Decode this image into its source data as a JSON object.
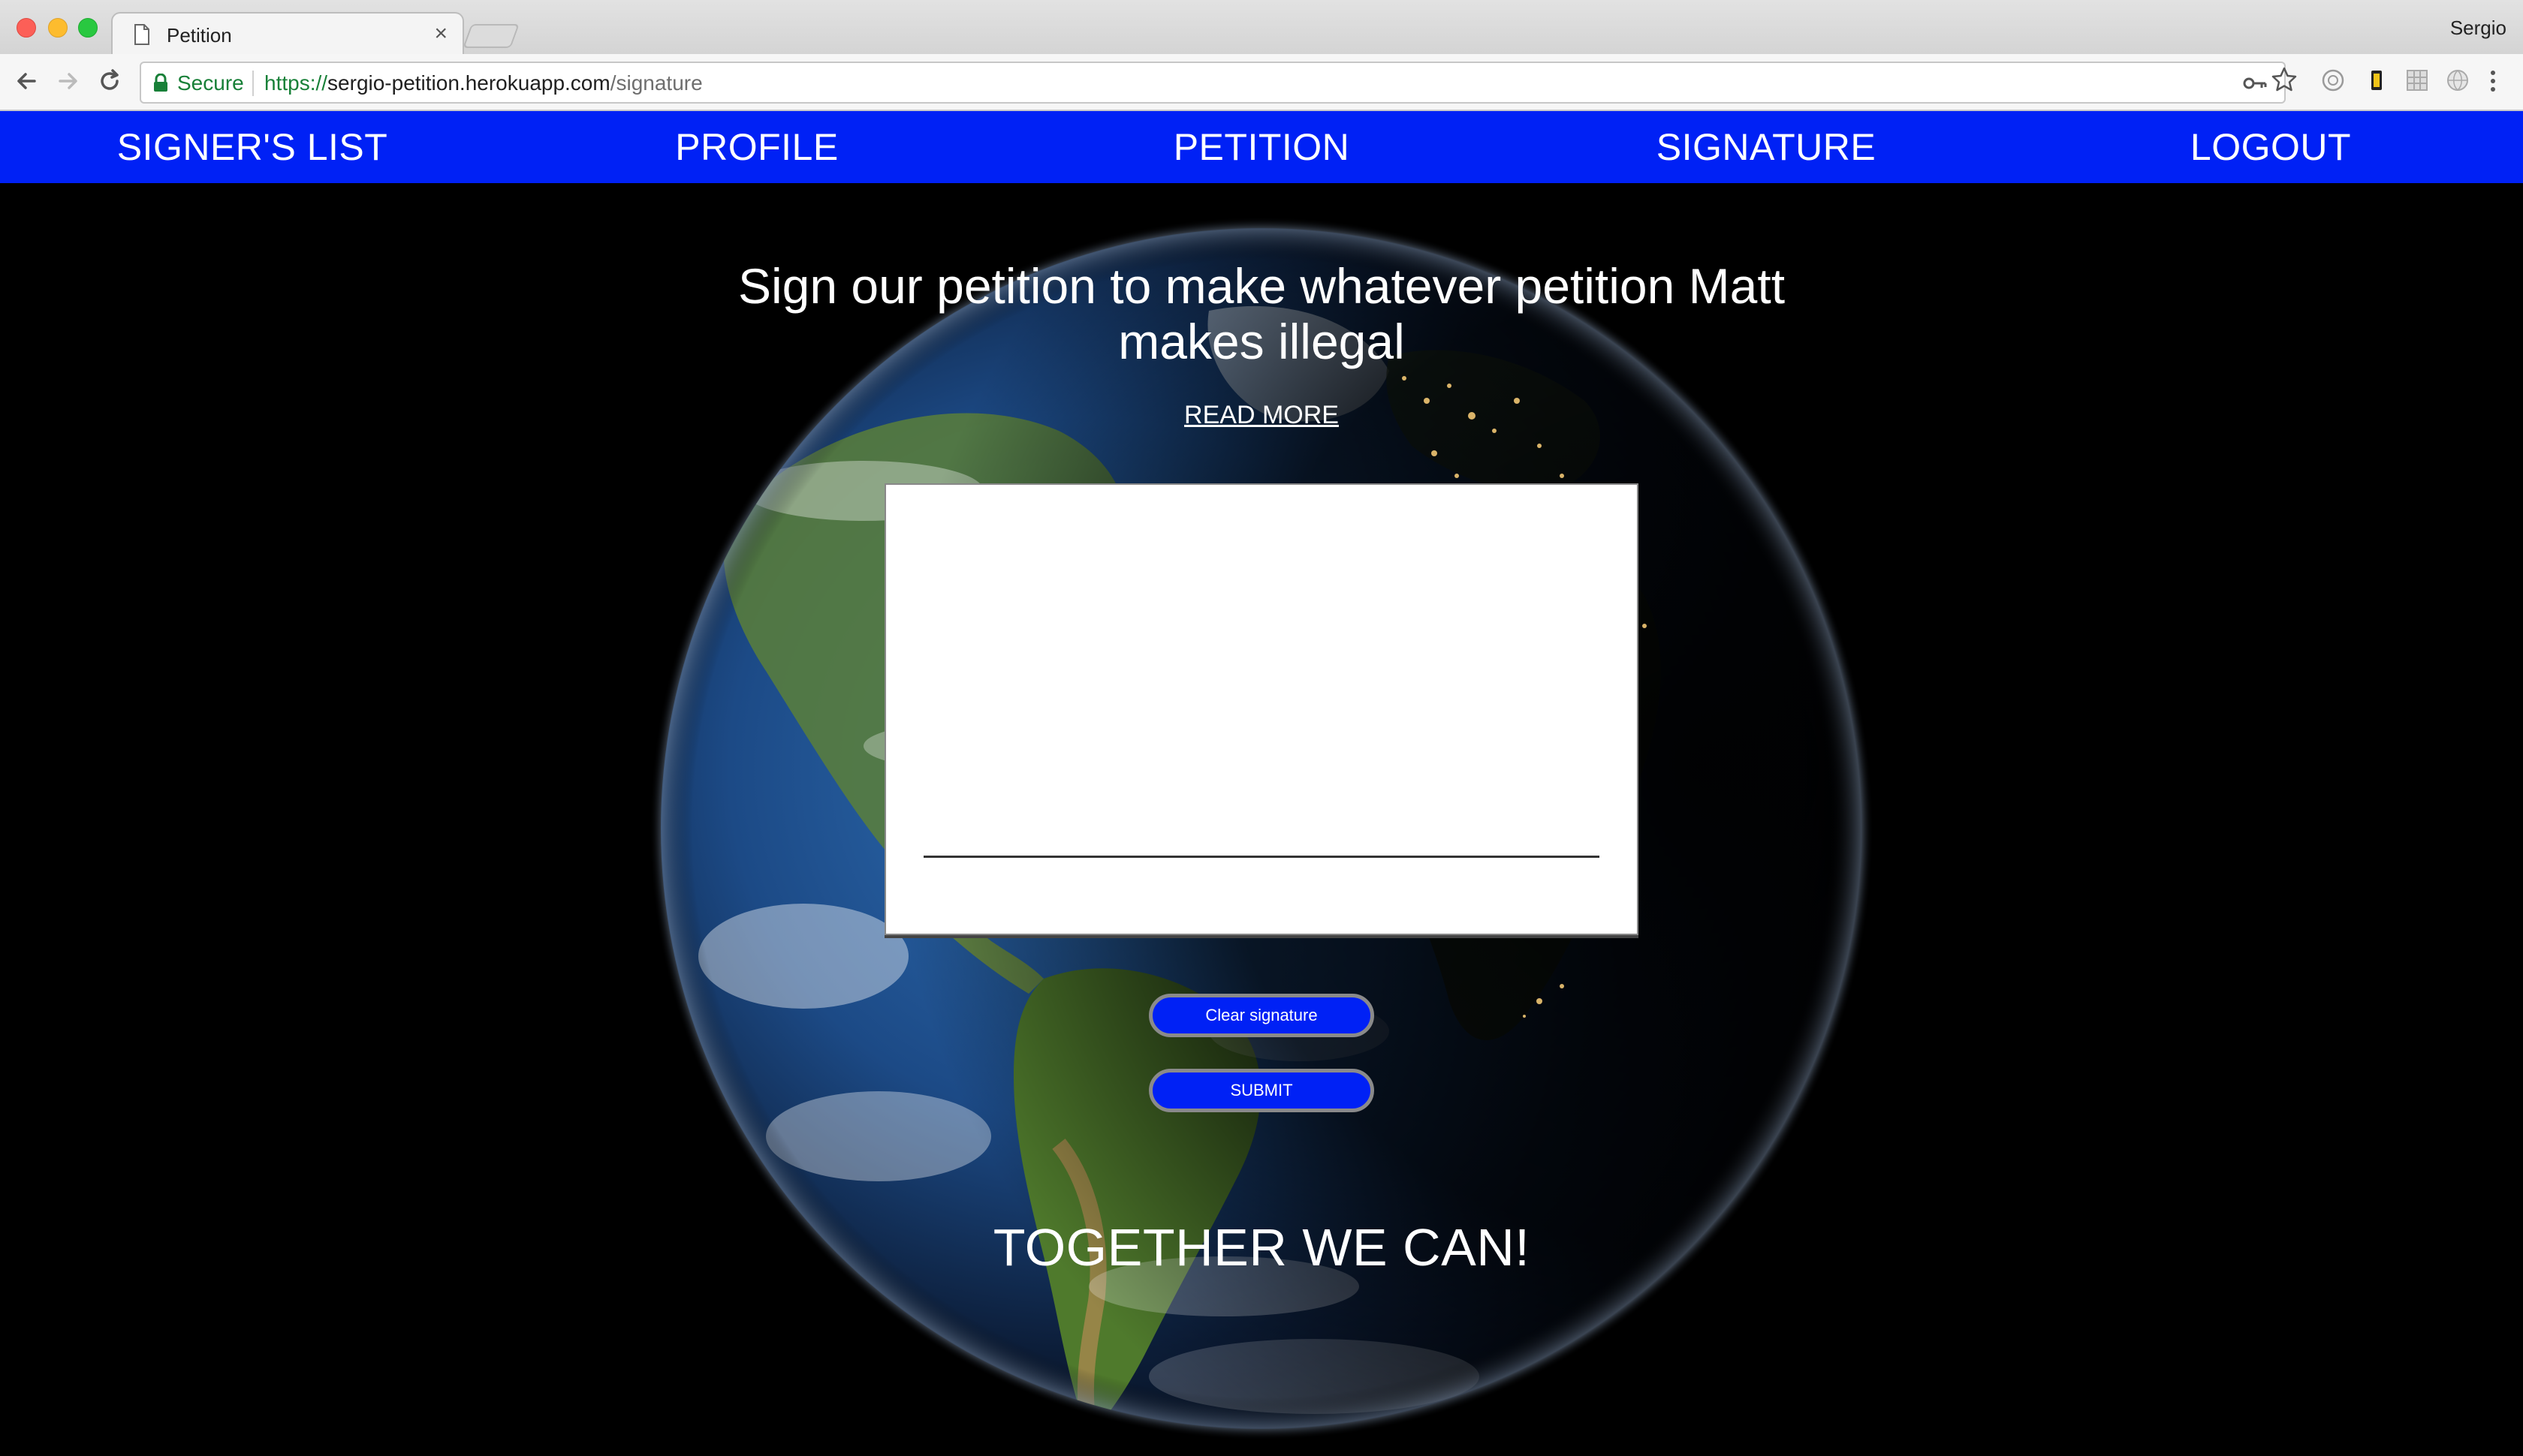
{
  "browser": {
    "tab_title": "Petition",
    "tab_close": "×",
    "profile_name": "Sergio",
    "secure_label": "Secure",
    "url_scheme": "https://",
    "url_host": "sergio-petition.herokuapp.com",
    "url_path": "/signature"
  },
  "nav": {
    "items": [
      {
        "label": "SIGNER'S LIST"
      },
      {
        "label": "PROFILE"
      },
      {
        "label": "PETITION"
      },
      {
        "label": "SIGNATURE"
      },
      {
        "label": "LOGOUT"
      }
    ],
    "background": "#0021f5"
  },
  "main": {
    "headline": "Sign our petition to make whatever petition Matt makes illegal",
    "read_more": "READ MORE",
    "clear_button": "Clear signature",
    "submit_button": "SUBMIT",
    "tagline": "TOGETHER WE CAN!"
  },
  "colors": {
    "accent": "#0021f5",
    "page_background": "#000000",
    "text": "#ffffff"
  }
}
